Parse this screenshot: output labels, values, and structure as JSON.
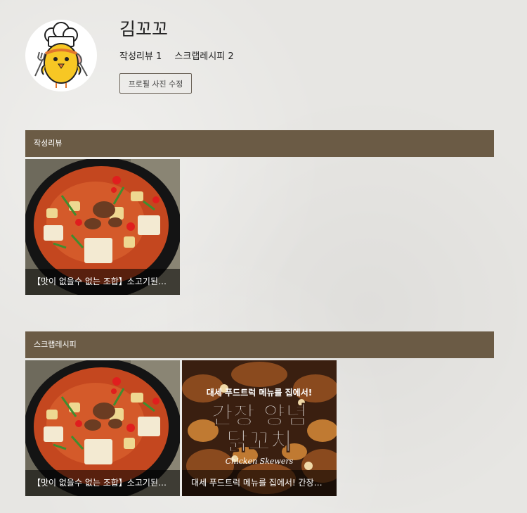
{
  "profile": {
    "name": "김꼬꼬",
    "stats": [
      {
        "label": "작성리뷰",
        "count": "1"
      },
      {
        "label": "스크랩레시피",
        "count": "2"
      }
    ],
    "edit_photo_label": "프로필 사진 수정"
  },
  "sections": {
    "reviews": {
      "title": "작성리뷰",
      "cards": [
        {
          "caption": "【맛이 없을수 없는 조합】소고기된장찌개",
          "image": "stew-photo"
        }
      ]
    },
    "scraps": {
      "title": "스크랩레시피",
      "cards": [
        {
          "caption": "【맛이 없을수 없는 조합】소고기된장찌개",
          "image": "stew-photo"
        },
        {
          "caption": "대세 푸드트럭 메뉴를 집에서! 간장양념닭꼬치",
          "image": "skewer-photo",
          "overlay": {
            "top_line": "대세 푸드트럭 메뉴를 집에서!",
            "title_line1": "간장 양념",
            "title_line2": "닭꼬치",
            "subtitle": "Chicken Skewers"
          }
        }
      ]
    }
  },
  "colors": {
    "section_bar": "#6b5b45",
    "background": "#e7e6e3",
    "caption_overlay": "rgba(0,0,0,0.55)"
  }
}
